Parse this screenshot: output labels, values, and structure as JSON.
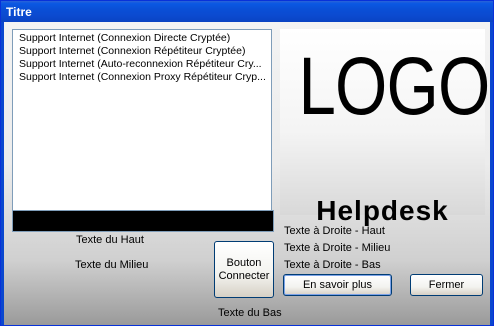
{
  "window": {
    "title": "Titre"
  },
  "list": {
    "items": [
      "Support Internet (Connexion Directe Cryptée)",
      "Support Internet (Connexion Répétiteur Cryptée)",
      "Support Internet (Auto-reconnexion Répétiteur Cry...",
      "Support Internet (Connexion Proxy Répétiteur Cryp..."
    ]
  },
  "logo": {
    "text": "LOGO",
    "subtitle": "Helpdesk"
  },
  "left_texts": {
    "haut": "Texte du Haut",
    "milieu": "Texte du Milieu",
    "bas": "Texte du Bas"
  },
  "right_texts": {
    "haut": "Texte à Droite - Haut",
    "milieu": "Texte à Droite - Milieu",
    "bas": "Texte à Droite - Bas"
  },
  "buttons": {
    "connect_line1": "Bouton",
    "connect_line2": "Connecter",
    "savoir_plus": "En savoir plus",
    "fermer": "Fermer"
  }
}
